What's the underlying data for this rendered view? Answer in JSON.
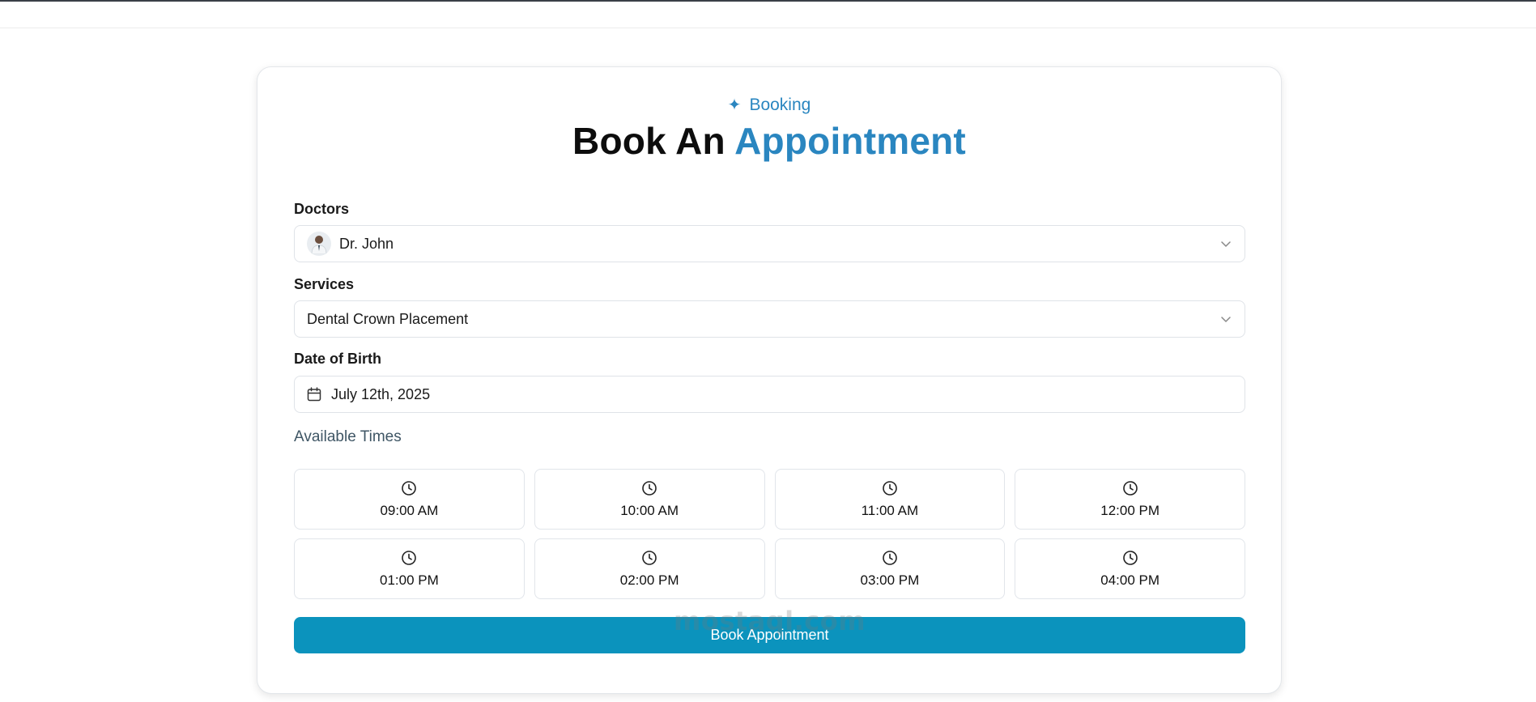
{
  "header": {
    "eyebrow": "Booking",
    "title_part1": "Book An",
    "title_accent": "Appointment"
  },
  "form": {
    "doctors": {
      "label": "Doctors",
      "value": "Dr. John"
    },
    "services": {
      "label": "Services",
      "value": "Dental Crown Placement"
    },
    "dob": {
      "label": "Date of Birth",
      "value": "July 12th, 2025"
    },
    "times_label": "Available Times",
    "times": [
      "09:00 AM",
      "10:00 AM",
      "11:00 AM",
      "12:00 PM",
      "01:00 PM",
      "02:00 PM",
      "03:00 PM",
      "04:00 PM"
    ],
    "submit_label": "Book Appointment"
  },
  "watermark": "mostaql.com",
  "colors": {
    "accent": "#2a86c0",
    "button": "#0b93bd",
    "border": "#dfe3e8"
  },
  "icons": {
    "eyebrow": "sparkle-icon",
    "dropdown": "chevron-down-icon",
    "date": "calendar-icon",
    "time": "clock-icon"
  }
}
